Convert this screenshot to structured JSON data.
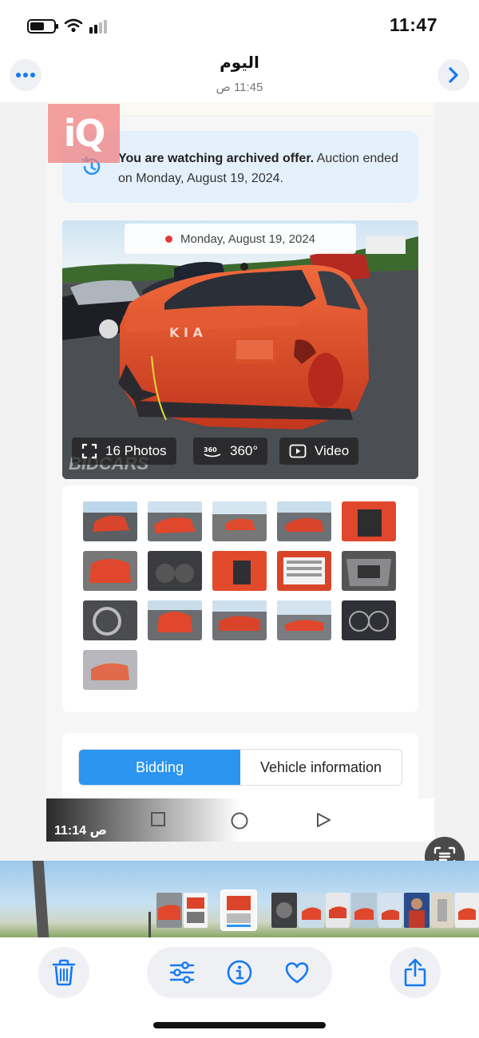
{
  "status_bar": {
    "time": "11:47",
    "battery_level": 0.6,
    "signal_bars_active": 2
  },
  "header": {
    "title": "اليوم",
    "subtitle": "11:45 ص",
    "more_icon": "ellipsis-icon",
    "next_icon": "chevron-right-icon"
  },
  "photo": {
    "watermark_logo": "iQ",
    "archive_notice": {
      "bold": "You are watching archived offer.",
      "rest": " Auction ended on Monday, August 19, 2024."
    },
    "date_label": "Monday, August 19, 2024",
    "car_brand_badge": "KIA",
    "media_buttons": {
      "photos": "16 Photos",
      "view360_icon_text": "360",
      "view360": "360°",
      "video": "Video"
    },
    "site_watermark": "BIDCARS",
    "tabs": {
      "bidding": "Bidding",
      "vehicle_info": "Vehicle information"
    },
    "overlay_time": "11:14 ص"
  },
  "colors": {
    "accent": "#2b95f0",
    "archive_bg": "#e4f0fb",
    "ios_blue": "#1479f5",
    "car_red": "#e0472c"
  },
  "toolbar": {
    "delete_icon": "trash-icon",
    "edit_icon": "sliders-icon",
    "info_icon": "info-icon",
    "favorite_icon": "heart-icon",
    "share_icon": "share-icon"
  }
}
